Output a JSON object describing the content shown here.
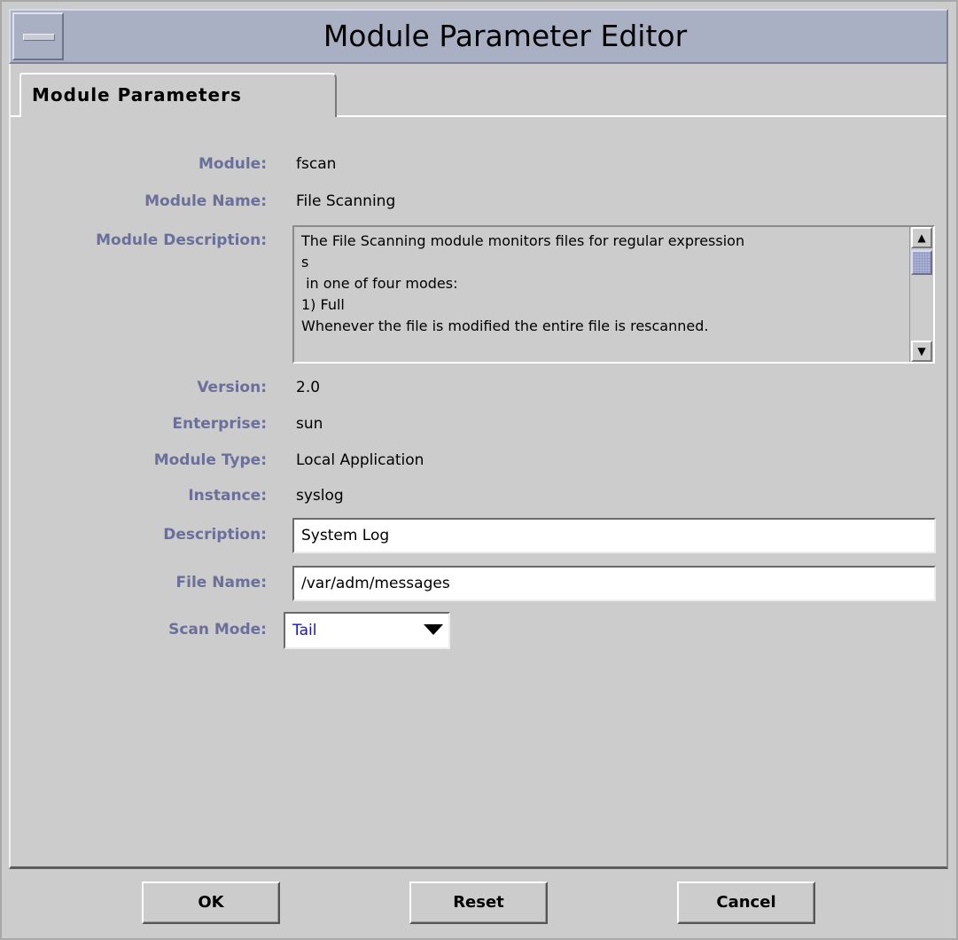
{
  "window": {
    "title": "Module Parameter Editor"
  },
  "tabs": [
    {
      "label": "Module Parameters",
      "selected": true
    }
  ],
  "fields": {
    "module": {
      "label": "Module:",
      "value": "fscan"
    },
    "module_name": {
      "label": "Module Name:",
      "value": "File Scanning"
    },
    "module_description": {
      "label": "Module Description:",
      "value": "The File Scanning module monitors files for regular expression\ns\n in one of four modes:\n1) Full\nWhenever the file is modified the entire file is rescanned."
    },
    "version": {
      "label": "Version:",
      "value": "2.0"
    },
    "enterprise": {
      "label": "Enterprise:",
      "value": "sun"
    },
    "module_type": {
      "label": "Module Type:",
      "value": "Local Application"
    },
    "instance": {
      "label": "Instance:",
      "value": "syslog"
    },
    "description": {
      "label": "Description:",
      "value": "System Log"
    },
    "file_name": {
      "label": "File Name:",
      "value": "/var/adm/messages"
    },
    "scan_mode": {
      "label": "Scan Mode:",
      "selected": "Tail"
    }
  },
  "buttons": {
    "ok": "OK",
    "reset": "Reset",
    "cancel": "Cancel"
  },
  "colors": {
    "label_text": "#6b6f9a",
    "titlebar": "#aab0c4",
    "panel_bg": "#cccccc",
    "scan_mode_value": "#1515c8",
    "scroll_thumb": "#a9b0d2"
  },
  "icons": {
    "window_menu": "window-menu-icon",
    "scroll_up": "scroll-up-arrow-icon",
    "scroll_down": "scroll-down-arrow-icon",
    "combo_dropdown": "dropdown-arrow-icon"
  }
}
